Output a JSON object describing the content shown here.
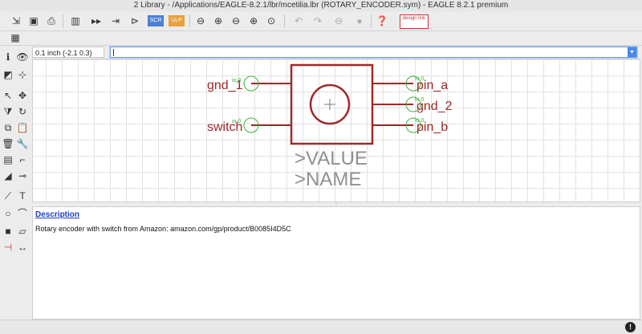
{
  "window": {
    "title": "2 Library - /Applications/EAGLE-8.2.1/lbr/mcetilia.lbr (ROTARY_ENCODER.sym) - EAGLE 8.2.1 premium"
  },
  "toolbar": {
    "items": [
      "open-icon",
      "save-icon",
      "print-icon",
      "library-icon",
      "package-icon",
      "symbol-icon",
      "device-icon",
      "scr-icon",
      "ulp-icon",
      "zoom-fit-icon",
      "zoom-in-icon",
      "zoom-out-icon",
      "zoom-select-icon",
      "zoom-last-icon",
      "undo-icon",
      "redo-icon",
      "stop-icon",
      "go-icon",
      "help-icon",
      "design-link-icon"
    ],
    "scr_label": "SCR",
    "ulp_label": "ULP",
    "design_link_label": "design link"
  },
  "coordinates": "0.1 inch (-2.1 0.3)",
  "command_input": "",
  "symbol": {
    "pins_left": [
      "gnd_1",
      "switch"
    ],
    "pins_right": [
      "pin_a",
      "gnd_2",
      "pin_b"
    ],
    "pin_attr": "io 0",
    "value_label": ">VALUE",
    "name_label": ">NAME"
  },
  "description": {
    "heading": "Description",
    "text": "Rotary encoder with switch from Amazon: amazon.com/gp/product/B0085I4D5C"
  },
  "colors": {
    "pin": "#9b2a2a",
    "symbol_line": "#9b2a2a",
    "pin_marker": "#3cb33c",
    "text_layer": "#909090",
    "link": "#1a3fc4"
  }
}
